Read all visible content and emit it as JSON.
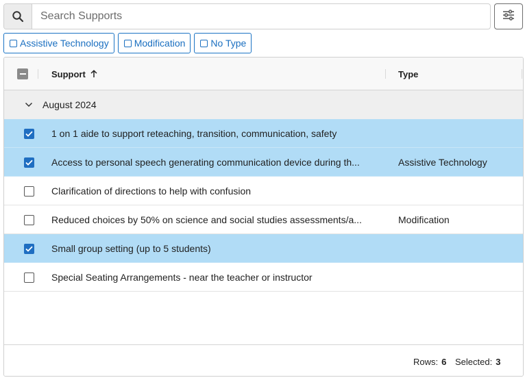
{
  "search": {
    "placeholder": "Search Supports",
    "icon": "search-icon"
  },
  "filter_button": {
    "icon": "sliders-icon"
  },
  "chips": [
    {
      "label": "Assistive Technology"
    },
    {
      "label": "Modification"
    },
    {
      "label": "No Type"
    }
  ],
  "grid": {
    "columns": {
      "support": "Support",
      "type": "Type"
    },
    "sort": {
      "column": "Support",
      "direction": "ascending",
      "icon": "arrow-up-icon"
    },
    "header_checkbox": "indeterminate",
    "group": {
      "label": "August 2024",
      "expanded": true
    },
    "rows": [
      {
        "support": "1 on 1 aide to support reteaching, transition, communication, safety",
        "type": "",
        "selected": true
      },
      {
        "support": "Access to personal speech generating communication device during th...",
        "type": "Assistive Technology",
        "selected": true
      },
      {
        "support": "Clarification of directions to help with confusion",
        "type": "",
        "selected": false
      },
      {
        "support": "Reduced choices by 50% on science and social studies assessments/a...",
        "type": "Modification",
        "selected": false
      },
      {
        "support": "Small group setting (up to 5 students)",
        "type": "",
        "selected": true
      },
      {
        "support": "Special Seating Arrangements - near the teacher or instructor",
        "type": "",
        "selected": false
      }
    ]
  },
  "footer": {
    "rows_label": "Rows:",
    "rows_value": "6",
    "selected_label": "Selected:",
    "selected_value": "3"
  },
  "colors": {
    "accent": "#1f6ec1",
    "selected_row": "#b1dcf6",
    "group_row": "#efefef"
  }
}
